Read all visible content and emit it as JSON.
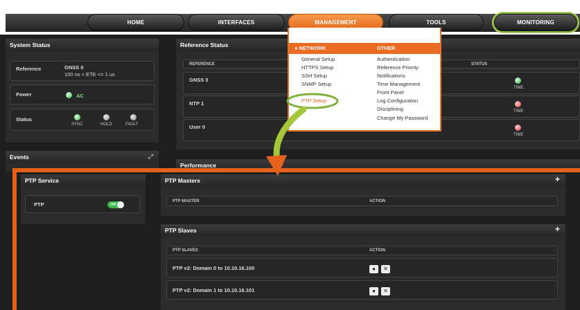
{
  "nav": {
    "home": "HOME",
    "interfaces": "INTERFACES",
    "management": "MANAGEMENT",
    "tools": "TOOLS",
    "monitoring": "MONITORING"
  },
  "system_status": {
    "title": "System Status",
    "reference_label": "Reference",
    "reference_value": "GNSS 0",
    "reference_detail": "100 ns < ETE <= 1 us",
    "power_label": "Power",
    "power_value": "AC",
    "status_label": "Status",
    "indicators": [
      "SYNC",
      "HOLD",
      "FAULT"
    ]
  },
  "reference_status": {
    "title": "Reference Status",
    "col_reference": "REFERENCE",
    "col_status": "STATUS",
    "rows": [
      {
        "name": "GNSS 0",
        "status": "TIME"
      },
      {
        "name": "NTP 1",
        "status": "TIME"
      },
      {
        "name": "User 0",
        "status": "TIME"
      }
    ]
  },
  "events": {
    "title": "Events"
  },
  "performance": {
    "title": "Performance"
  },
  "management_menu": {
    "network_head": "NETWORK",
    "other_head": "OTHER",
    "network_items": [
      "General Setup",
      "HTTPS Setup",
      "SSH Setup",
      "SNMP Setup",
      "PTP Setup"
    ],
    "other_items": [
      "Authentication",
      "Reference Priority",
      "Notifications",
      "Time Management",
      "Front Panel",
      "Log Configuration",
      "Disciplining",
      "Change My Password"
    ]
  },
  "ptp_service": {
    "title": "PTP Service",
    "label": "PTP",
    "toggle": "ON"
  },
  "ptp_masters": {
    "title": "PTP Masters",
    "col_master": "PTP MASTER",
    "col_action": "ACTION",
    "add": "+"
  },
  "ptp_slaves": {
    "title": "PTP Slaves",
    "col_slaves": "PTP SLAVES",
    "col_action": "ACTION",
    "add": "+",
    "rows": [
      "PTP v2: Domain 0 to 10.10.16.100",
      "PTP v2: Domain 1 to 10.10.16.101"
    ]
  },
  "colors": {
    "accent": "#e4621b",
    "ok": "#3bb84a",
    "alarm": "#e03a3a",
    "highlight_ring": "#7fb23a"
  }
}
